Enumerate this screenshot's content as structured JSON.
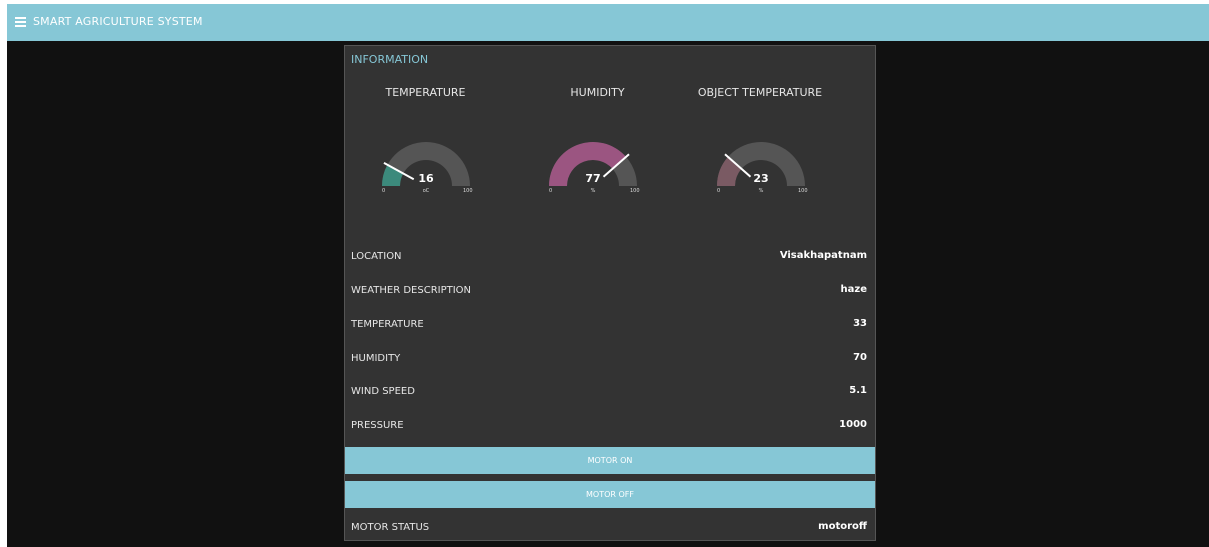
{
  "header": {
    "title": "SMART AGRICULTURE SYSTEM",
    "menu_icon": "hamburger-menu-icon"
  },
  "panel": {
    "title": "INFORMATION",
    "gauges": [
      {
        "label": "TEMPERATURE",
        "value": "16",
        "unit": "oC",
        "min": "0",
        "max": "100",
        "fraction": 0.16,
        "fill_color": "#3c8a7c"
      },
      {
        "label": "HUMIDITY",
        "value": "77",
        "unit": "%",
        "min": "0",
        "max": "100",
        "fraction": 0.77,
        "fill_color": "#9b5581"
      },
      {
        "label": "OBJECT TEMPERATURE",
        "value": "23",
        "unit": "%",
        "min": "0",
        "max": "100",
        "fraction": 0.23,
        "fill_color": "#7a5a63"
      }
    ],
    "info": [
      {
        "label": "LOCATION",
        "value": "Visakhapatnam"
      },
      {
        "label": "WEATHER DESCRIPTION",
        "value": "haze"
      },
      {
        "label": "TEMPERATURE",
        "value": "33"
      },
      {
        "label": "HUMIDITY",
        "value": "70"
      },
      {
        "label": "WIND SPEED",
        "value": "5.1"
      },
      {
        "label": "PRESSURE",
        "value": "1000"
      }
    ],
    "buttons": {
      "motor_on": "MOTOR ON",
      "motor_off": "MOTOR OFF"
    },
    "status": {
      "label": "MOTOR STATUS",
      "value": "motoroff"
    }
  },
  "colors": {
    "accent": "#86c7d6",
    "panel_bg": "#333333",
    "page_bg": "#111111",
    "gauge_track": "#555555"
  }
}
